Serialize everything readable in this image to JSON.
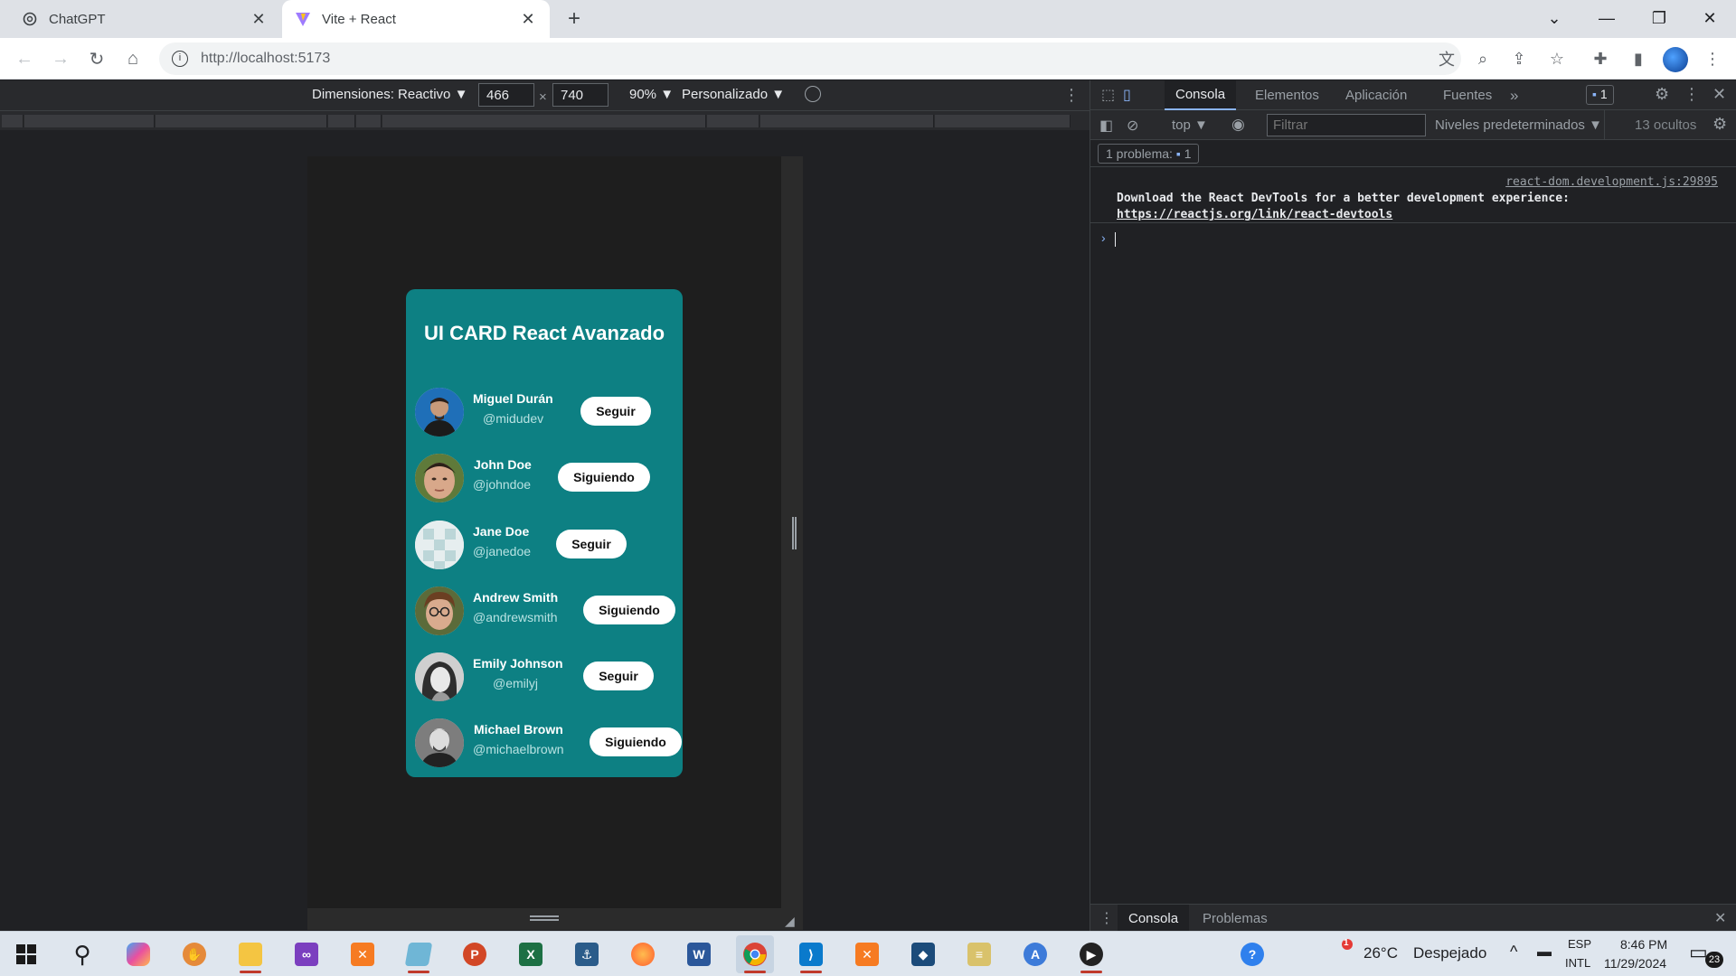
{
  "browser": {
    "tabs": [
      {
        "title": "ChatGPT",
        "icon": "chatgpt-icon"
      },
      {
        "title": "Vite + React",
        "icon": "vite-icon"
      }
    ],
    "url": "http://localhost:5173"
  },
  "device_toolbar": {
    "dimensions_label": "Dimensiones: Reactivo ▼",
    "width": "466",
    "height": "740",
    "times": "×",
    "zoom": "90% ▼",
    "throttle": "Personalizado ▼"
  },
  "card": {
    "title": "UI CARD React Avanzado",
    "users": [
      {
        "name": "Miguel Durán",
        "handle": "@midudev",
        "button": "Seguir",
        "following": false
      },
      {
        "name": "John Doe",
        "handle": "@johndoe",
        "button": "Siguiendo",
        "following": true
      },
      {
        "name": "Jane Doe",
        "handle": "@janedoe",
        "button": "Seguir",
        "following": false
      },
      {
        "name": "Andrew Smith",
        "handle": "@andrewsmith",
        "button": "Siguiendo",
        "following": true
      },
      {
        "name": "Emily Johnson",
        "handle": "@emilyj",
        "button": "Seguir",
        "following": false
      },
      {
        "name": "Michael Brown",
        "handle": "@michaelbrown",
        "button": "Siguiendo",
        "following": true
      }
    ],
    "colors": {
      "card_bg": "#0d8083",
      "button_bg": "#ffffff"
    }
  },
  "devtools": {
    "tabs": [
      "Consola",
      "Elementos",
      "Aplicación",
      "Fuentes"
    ],
    "more": "»",
    "issues_badge": "1",
    "context": "top ▼",
    "filter_placeholder": "Filtrar",
    "levels": "Niveles predeterminados ▼",
    "hidden": "13 ocultos",
    "issues_label": "1 problema:",
    "issues_count": "1",
    "message_source": "react-dom.development.js:29895",
    "message_text": "Download the React DevTools for a better development experience: ",
    "message_link": "https://reactjs.org/link/react-devtools",
    "drawer_tabs": [
      "Consola",
      "Problemas"
    ]
  },
  "taskbar": {
    "weather_temp": "26°C",
    "weather_desc": "Despejado",
    "lang": "ESP",
    "layout": "INTL",
    "time": "8:46 PM",
    "date": "11/29/2024",
    "notifications": "23",
    "weather_alert": "1"
  }
}
